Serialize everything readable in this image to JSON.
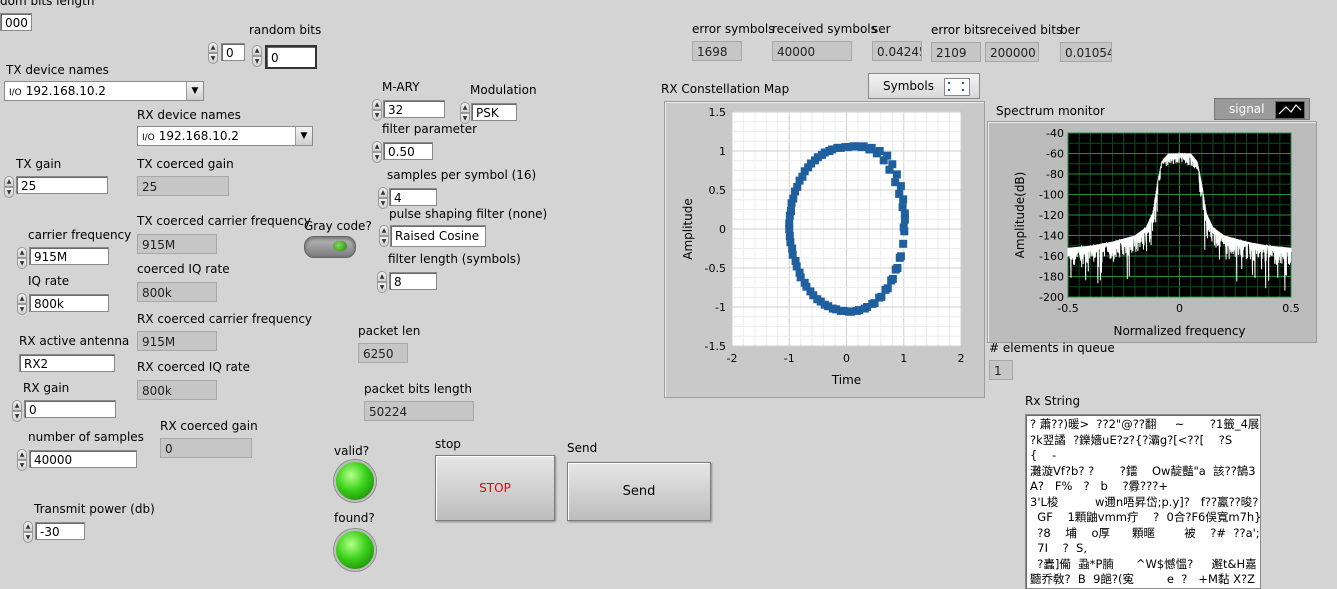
{
  "left": {
    "random_bits_length_label": "dom bits length",
    "random_bits_length_value": "000",
    "random_bits_label": "random bits",
    "random_bits_a": "0",
    "random_bits_b": "0",
    "tx_device_label": "TX device names",
    "tx_device_value": "192.168.10.2",
    "rx_device_label": "RX device names",
    "rx_device_value": "192.168.10.2",
    "tx_gain_label": "TX gain",
    "tx_gain_value": "25",
    "tx_coerced_gain_label": "TX coerced gain",
    "tx_coerced_gain_value": "25",
    "carrier_freq_label": "carrier frequency",
    "carrier_freq_value": "915M",
    "tx_coerced_carrier_label": "TX coerced carrier frequency",
    "tx_coerced_carrier_value": "915M",
    "iq_rate_label": "IQ rate",
    "iq_rate_value": "800k",
    "coerced_iq_label": "coerced IQ rate",
    "coerced_iq_value": "800k",
    "rx_antenna_label": "RX active antenna",
    "rx_antenna_value": "RX2",
    "rx_coerced_carrier_label": "RX coerced carrier frequency",
    "rx_coerced_carrier_value": "915M",
    "rx_gain_label": "RX gain",
    "rx_gain_value": "0",
    "rx_coerced_iq_label": "RX coerced IQ rate",
    "rx_coerced_iq_value": "800k",
    "num_samples_label": "number of samples",
    "num_samples_value": "40000",
    "rx_coerced_gain_label": "RX coerced gain",
    "rx_coerced_gain_value": "0",
    "tx_power_label": "Transmit power (db)",
    "tx_power_value": "-30",
    "io_glyph": "I/O"
  },
  "middle": {
    "mary_label": "M-ARY",
    "mary_value": "32",
    "modulation_label": "Modulation",
    "modulation_value": "PSK",
    "filter_param_label": "filter parameter",
    "filter_param_value": "0.50",
    "sps_label": "samples per symbol (16)",
    "sps_value": "4",
    "gray_code_label": "Gray code?",
    "pulse_shaping_label": "pulse shaping filter (none)",
    "pulse_shaping_value": "Raised Cosine",
    "filter_length_label": "filter length (symbols)",
    "filter_length_value": "8",
    "packet_len_label": "packet len",
    "packet_len_value": "6250",
    "packet_bits_label": "packet bits length",
    "packet_bits_value": "50224",
    "valid_label": "valid?",
    "found_label": "found?",
    "stop_label": "stop",
    "stop_button": "STOP",
    "send_label": "Send",
    "send_button": "Send"
  },
  "stats": {
    "error_symbols_label": "error symbols",
    "error_symbols_value": "1698",
    "received_symbols_label": "received symbols",
    "received_symbols_value": "40000",
    "ser_label": "ser",
    "ser_value": "0.04245",
    "error_bits_label": "error bits",
    "error_bits_value": "2109",
    "received_bits_label": "received bits",
    "received_bits_value": "200000",
    "ber_label": "ber",
    "ber_value": "0.01054"
  },
  "constellation": {
    "title": "RX Constellation Map",
    "legend_label": "Symbols",
    "xlabel": "Time",
    "ylabel": "Amplitude",
    "x_ticks": [
      "-2",
      "-1",
      "0",
      "1",
      "2"
    ],
    "y_ticks": [
      "1.5",
      "1",
      "0.5",
      "0",
      "-0.5",
      "-1",
      "-1.5"
    ],
    "point_color": "#1f5f9e"
  },
  "spectrum": {
    "title": "Spectrum monitor",
    "legend_label": "signal",
    "xlabel": "Normalized frequency",
    "ylabel": "Amplitude(dB)",
    "x_ticks": [
      "-0.5",
      "0",
      "0.5"
    ],
    "y_ticks": [
      "-40",
      "-60",
      "-80",
      "-100",
      "-120",
      "-140",
      "-160",
      "-180",
      "-200"
    ]
  },
  "queue": {
    "label": "# elements in queue",
    "value": "1"
  },
  "rx_string": {
    "label": "Rx String",
    "lines": [
      "? 蕭??)暖>  ??2\"@??翻     ~       ?1籤_4展",
      "?k翌譎  ?鑠嬙uE?z?{?灞g?[<??[    ?S",
      "{    -",
      "灘漩Vf?b? ?       ?鐳    Ow靛豔\"a  該??鵠3",
      "A?   F%   ?   b    ?釁???+",
      "3'L梭          w邇n唔昇岱;p.y]?   f??鸁??晙?",
      "  GF    1顆鼬vmm疔    ?  0合?F6俁寬m7h}U",
      "  ?8    埔    o厚      顆暱        被    ?#  ??a';Q",
      "  7I    ?  S,",
      "  ?蠹]僃  蝨*P腩      ^W$憾慍?     邂t&H嘉",
      "聽乔敎?  B  9郒?(寃         e  ?   +M黏 X?Z"
    ]
  },
  "chart_data": [
    {
      "type": "scatter",
      "title": "RX Constellation Map",
      "xlabel": "Time",
      "ylabel": "Amplitude",
      "xlim": [
        -2,
        2
      ],
      "ylim": [
        -1.5,
        1.5
      ],
      "grid": true,
      "legend": "Symbols",
      "series": [
        {
          "name": "Symbols",
          "x": [
            1.0,
            1.02,
            0.99,
            0.95,
            0.88,
            0.8,
            0.71,
            0.58,
            0.44,
            0.3,
            0.17,
            0.03,
            -0.1,
            -0.25,
            -0.38,
            -0.5,
            -0.62,
            -0.73,
            -0.82,
            -0.9,
            -0.96,
            -0.99,
            -1.0,
            -0.98,
            -0.94,
            -0.87,
            -0.8,
            -0.7,
            -0.58,
            -0.45,
            -0.32,
            -0.18,
            -0.05,
            0.08,
            0.22,
            0.36,
            0.49,
            0.61,
            0.72,
            0.81,
            0.89,
            0.95,
            0.99,
            1.01,
            1.02,
            0.98,
            0.92,
            0.85,
            0.75,
            0.65,
            0.53,
            0.4,
            0.26,
            0.12,
            -0.02,
            -0.16,
            -0.3,
            -0.43,
            -0.55,
            -0.67,
            -0.77,
            -0.86,
            -0.93,
            -0.97,
            -1.0,
            -0.99,
            -0.95,
            -0.89,
            -0.82,
            -0.73,
            -0.63,
            -0.51,
            -0.38,
            -0.24,
            -0.1,
            0.04,
            0.18,
            0.32,
            0.45,
            0.57,
            0.68,
            0.78,
            0.86,
            0.93
          ],
          "y": [
            0.02,
            0.2,
            0.38,
            0.55,
            0.7,
            0.83,
            0.94,
            1.0,
            1.04,
            1.06,
            1.06,
            1.05,
            1.04,
            1.02,
            0.98,
            0.92,
            0.84,
            0.74,
            0.62,
            0.48,
            0.33,
            0.17,
            0.0,
            -0.17,
            -0.33,
            -0.48,
            -0.62,
            -0.74,
            -0.85,
            -0.93,
            -0.99,
            -1.03,
            -1.05,
            -1.06,
            -1.04,
            -1.0,
            -0.95,
            -0.87,
            -0.76,
            -0.64,
            -0.5,
            -0.35,
            -0.19,
            -0.03,
            0.12,
            0.28,
            0.45,
            0.6,
            0.76,
            0.88,
            0.97,
            1.02,
            1.05,
            1.06,
            1.05,
            1.04,
            1.0,
            0.95,
            0.88,
            0.79,
            0.67,
            0.54,
            0.39,
            0.23,
            0.07,
            -0.09,
            -0.25,
            -0.41,
            -0.56,
            -0.69,
            -0.8,
            -0.9,
            -0.97,
            -1.02,
            -1.05,
            -1.06,
            -1.05,
            -1.02,
            -0.96,
            -0.88,
            -0.78,
            -0.66,
            -0.52,
            -0.37
          ]
        }
      ]
    },
    {
      "type": "line",
      "title": "Spectrum monitor",
      "xlabel": "Normalized frequency",
      "ylabel": "Amplitude(dB)",
      "xlim": [
        -0.5,
        0.5
      ],
      "ylim": [
        -200,
        -40
      ],
      "grid": true,
      "legend": "signal",
      "series": [
        {
          "name": "signal",
          "x": [
            -0.5,
            -0.45,
            -0.4,
            -0.35,
            -0.3,
            -0.25,
            -0.2,
            -0.15,
            -0.12,
            -0.1,
            -0.08,
            -0.05,
            0.0,
            0.05,
            0.08,
            0.1,
            0.12,
            0.15,
            0.2,
            0.25,
            0.3,
            0.35,
            0.4,
            0.45,
            0.5
          ],
          "y": [
            -152,
            -151,
            -150,
            -148,
            -146,
            -143,
            -140,
            -132,
            -118,
            -90,
            -68,
            -60,
            -60,
            -60,
            -68,
            -90,
            -118,
            -132,
            -140,
            -143,
            -146,
            -148,
            -150,
            -151,
            -152
          ]
        }
      ]
    }
  ]
}
